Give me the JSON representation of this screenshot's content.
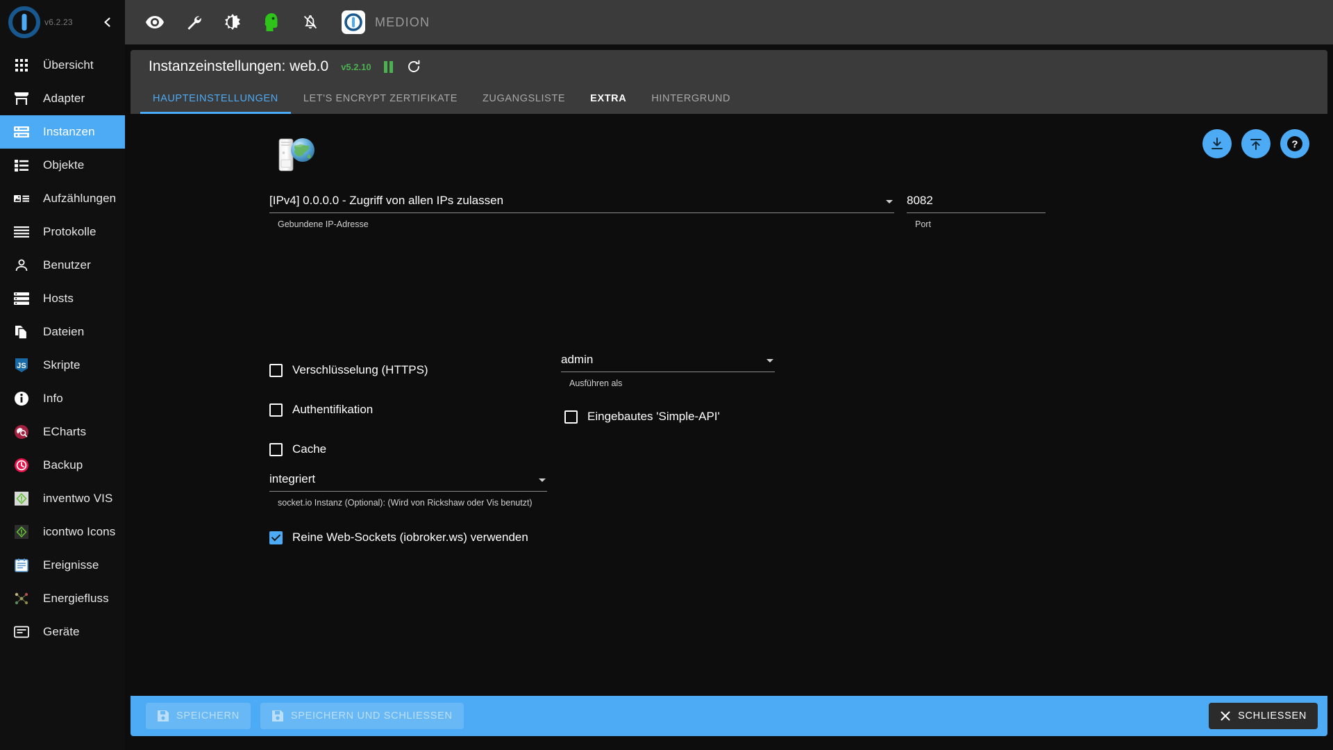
{
  "sidebar": {
    "version": "v6.2.23",
    "collapse_icon": "chevron-left-icon",
    "items": [
      {
        "label": "Übersicht",
        "icon": "grid-icon",
        "selected": false
      },
      {
        "label": "Adapter",
        "icon": "store-icon",
        "selected": false
      },
      {
        "label": "Instanzen",
        "icon": "instances-icon",
        "selected": true
      },
      {
        "label": "Objekte",
        "icon": "list-icon",
        "selected": false
      },
      {
        "label": "Aufzählungen",
        "icon": "enums-icon",
        "selected": false
      },
      {
        "label": "Protokolle",
        "icon": "lines-icon",
        "selected": false
      },
      {
        "label": "Benutzer",
        "icon": "person-icon",
        "selected": false
      },
      {
        "label": "Hosts",
        "icon": "server-icon",
        "selected": false
      },
      {
        "label": "Dateien",
        "icon": "files-icon",
        "selected": false
      },
      {
        "label": "Skripte",
        "icon": "js-icon",
        "selected": false
      },
      {
        "label": "Info",
        "icon": "info-icon",
        "selected": false
      },
      {
        "label": "ECharts",
        "icon": "echarts-icon",
        "selected": false
      },
      {
        "label": "Backup",
        "icon": "backup-clock-icon",
        "selected": false
      },
      {
        "label": "inventwo VIS",
        "icon": "inventwo-icon",
        "selected": false
      },
      {
        "label": "icontwo Icons",
        "icon": "icontwo-icon",
        "selected": false
      },
      {
        "label": "Ereignisse",
        "icon": "events-icon",
        "selected": false
      },
      {
        "label": "Energiefluss",
        "icon": "energyflow-icon",
        "selected": false
      },
      {
        "label": "Geräte",
        "icon": "devices-icon",
        "selected": false
      }
    ]
  },
  "topbar": {
    "icons": [
      "eye-icon",
      "wrench-icon",
      "brightness-icon",
      "expert-head-icon",
      "notifications-off-icon"
    ],
    "brand": "MEDION",
    "brand_logo_icon": "iobroker-logo-icon"
  },
  "panel": {
    "title": "Instanzeinstellungen: web.0",
    "version": "v5.2.10",
    "pause_icon": "pause-icon",
    "refresh_icon": "refresh-icon",
    "tabs": [
      {
        "label": "Haupteinstellungen",
        "state": "active"
      },
      {
        "label": "Let's Encrypt Zertifikate",
        "state": "normal"
      },
      {
        "label": "Zugangsliste",
        "state": "normal"
      },
      {
        "label": "Extra",
        "state": "hover"
      },
      {
        "label": "Hintergrund",
        "state": "normal"
      }
    ]
  },
  "actions": {
    "import_icon": "download-icon",
    "export_icon": "upload-icon",
    "help_icon": "help-icon"
  },
  "form": {
    "adapter_icon": "web-adapter-icon",
    "bind_ip": {
      "value": "[IPv4] 0.0.0.0 - Zugriff von allen IPs zulassen",
      "label": "Gebundene IP-Adresse"
    },
    "port": {
      "value": "8082",
      "label": "Port"
    },
    "https": {
      "label": "Verschlüsselung (HTTPS)",
      "checked": false
    },
    "auth": {
      "label": "Authentifikation",
      "checked": false
    },
    "cache": {
      "label": "Cache",
      "checked": false
    },
    "run_as": {
      "value": "admin",
      "label": "Ausführen als"
    },
    "simple_api": {
      "label": "Eingebautes 'Simple-API'",
      "checked": false
    },
    "socketio": {
      "value": "integriert",
      "label": "socket.io Instanz (Optional): (Wird von Rickshaw oder Vis benutzt)"
    },
    "pure_ws": {
      "label": "Reine Web-Sockets (iobroker.ws) verwenden",
      "checked": true
    }
  },
  "footer": {
    "save": "Speichern",
    "save_close": "Speichern und schliessen",
    "close": "Schliessen",
    "save_icon": "save-icon",
    "close_icon": "close-x-icon"
  },
  "colors": {
    "accent": "#4dabf5",
    "panel_bg": "#3b3b3b",
    "content_bg": "#0d0d0d",
    "sidebar_bg": "#101010",
    "version_green": "#4caf50"
  }
}
